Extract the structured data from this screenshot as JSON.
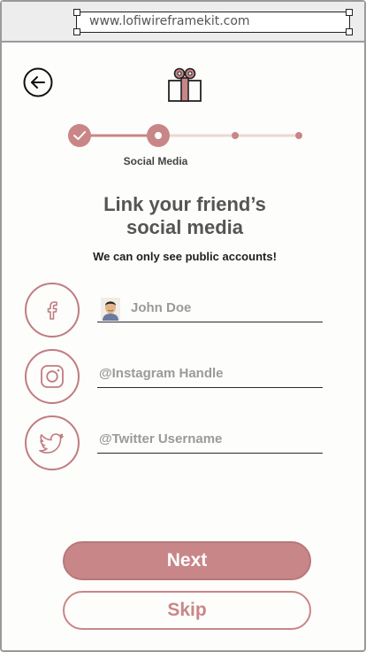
{
  "browser": {
    "url": "www.lofiwireframekit.com"
  },
  "header": {
    "back_icon": "back-arrow-icon",
    "logo_icon": "gift-icon"
  },
  "stepper": {
    "steps_total": 4,
    "current_step": 2,
    "current_label": "Social Media",
    "completed_icon": "check-icon"
  },
  "content": {
    "title_line1": "Link your friend’s",
    "title_line2": "social media",
    "subtitle": "We can only see public accounts!"
  },
  "fields": {
    "facebook": {
      "icon": "facebook-icon",
      "value": "John Doe"
    },
    "instagram": {
      "icon": "instagram-icon",
      "placeholder": "@Instagram Handle"
    },
    "twitter": {
      "icon": "twitter-icon",
      "placeholder": "@Twitter Username"
    }
  },
  "actions": {
    "next_label": "Next",
    "skip_label": "Skip"
  },
  "colors": {
    "accent": "#c98688",
    "accent_light": "#ead9d2",
    "text_dark": "#555555"
  }
}
